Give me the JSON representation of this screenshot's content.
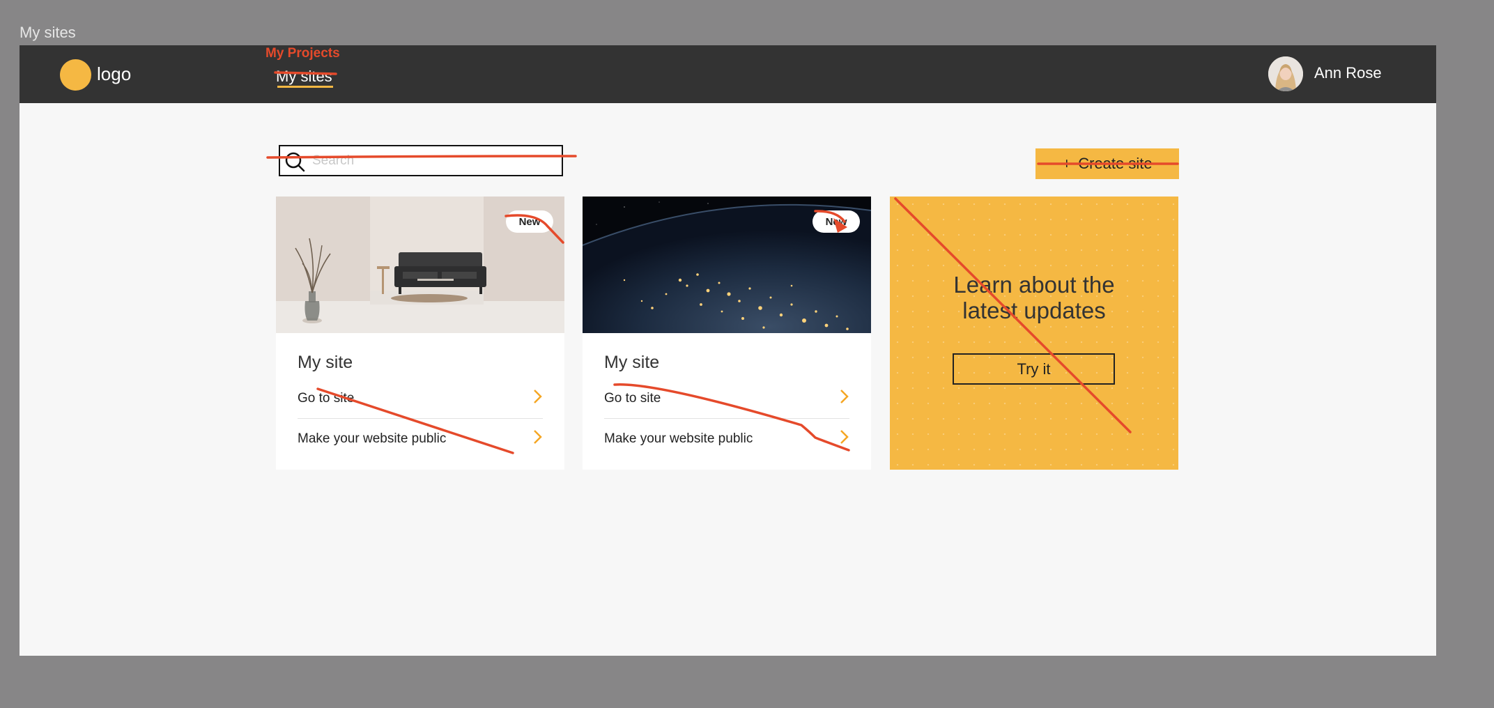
{
  "frame": {
    "label": "My sites"
  },
  "header": {
    "logo_text": "logo",
    "nav_tab": "My sites",
    "user_name": "Ann Rose"
  },
  "annotations": {
    "nav_rename": "My Projects"
  },
  "search": {
    "placeholder": "Search",
    "value": ""
  },
  "toolbar": {
    "create_icon": "+",
    "create_label": "Create site"
  },
  "cards": [
    {
      "image": "living-room-photo",
      "badge": "New",
      "title": "My site",
      "links": [
        {
          "label": "Go to site"
        },
        {
          "label": "Make your website public"
        }
      ]
    },
    {
      "image": "earth-night-photo",
      "badge": "New",
      "title": "My site",
      "links": [
        {
          "label": "Go to site"
        },
        {
          "label": "Make your website public"
        }
      ]
    }
  ],
  "promo": {
    "title_line1": "Learn about the",
    "title_line2": "latest updates",
    "button_label": "Try it"
  },
  "colors": {
    "accent": "#f5b843",
    "header_bg": "#333333",
    "annotation": "#e54a2b",
    "canvas": "#878687",
    "surface": "#f7f7f7"
  }
}
